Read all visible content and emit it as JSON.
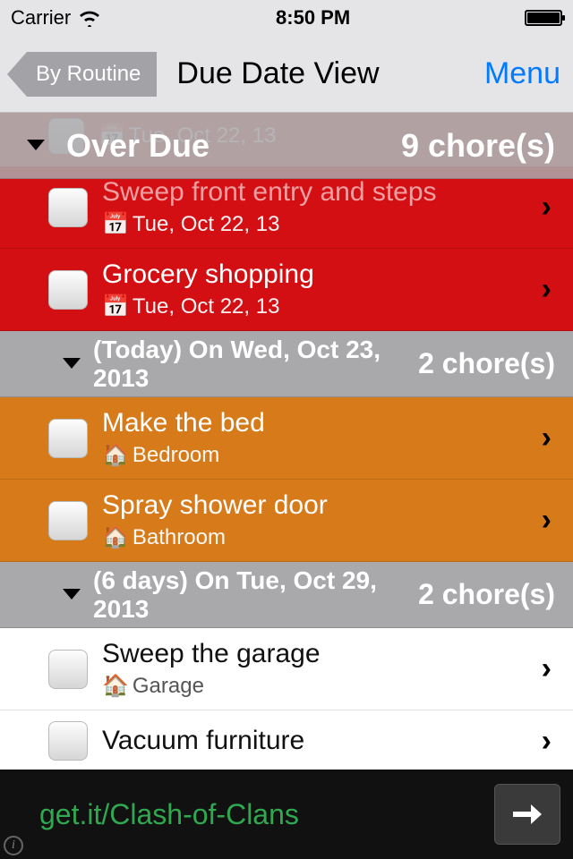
{
  "status": {
    "carrier": "Carrier",
    "time": "8:50 PM"
  },
  "nav": {
    "back_label": "By Routine",
    "title": "Due Date View",
    "menu_label": "Menu"
  },
  "sections": {
    "overdue": {
      "label": "Over Due",
      "count": "9 chore(s)"
    },
    "today": {
      "label": "(Today) On Wed, Oct 23, 2013",
      "count": "2 chore(s)"
    },
    "future": {
      "label": "(6 days) On Tue, Oct 29, 2013",
      "count": "2 chore(s)"
    }
  },
  "rows": {
    "ghost_date": "Tue, Oct 22, 13",
    "r1": {
      "title": "Sweep front entry and steps",
      "sub": "Tue, Oct 22, 13",
      "icon": "📅"
    },
    "r2": {
      "title": "Grocery shopping",
      "sub": "Tue, Oct 22, 13",
      "icon": "📅"
    },
    "r3": {
      "title": "Make the bed",
      "sub": "Bedroom",
      "icon": "🏠"
    },
    "r4": {
      "title": "Spray shower door",
      "sub": "Bathroom",
      "icon": "🏠"
    },
    "r5": {
      "title": "Sweep the garage",
      "sub": "Garage",
      "icon": "🏠"
    },
    "r6": {
      "title": "Vacuum furniture",
      "sub": "",
      "icon": ""
    }
  },
  "ad": {
    "text": "get.it/Clash-of-Clans"
  }
}
